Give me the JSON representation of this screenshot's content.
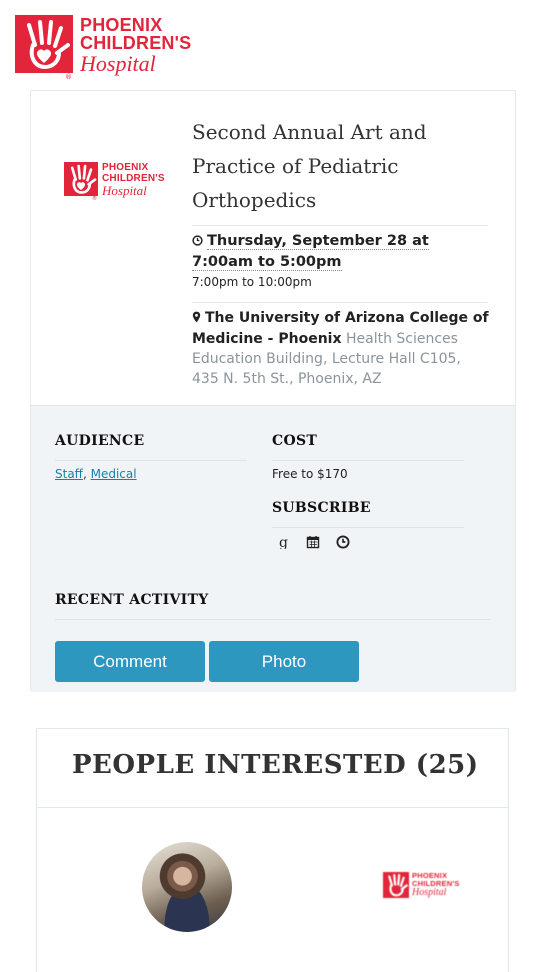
{
  "brand": {
    "line1": "PHOENIX",
    "line2": "CHILDREN'S",
    "line3": "Hospital",
    "registered": "®",
    "color": "#e2253a"
  },
  "event": {
    "title": "Second Annual Art and Practice of Pediatric Orthopedics",
    "when_main": "Thursday, September 28 at",
    "when_range": "7:00am to 5:00pm",
    "when_sub": "7:00pm to 10:00pm",
    "venue": "The University of Arizona College of Medicine - Phoenix",
    "address": "Health Sciences Education Building, Lecture Hall C105, 435 N. 5th St., Phoenix, AZ"
  },
  "details": {
    "audience_label": "AUDIENCE",
    "audience_items": [
      "Staff",
      "Medical"
    ],
    "cost_label": "COST",
    "cost_value": "Free to $170",
    "subscribe_label": "SUBSCRIBE",
    "subscribe_icons": [
      "google-icon",
      "calendar-icon",
      "clock-icon"
    ]
  },
  "activity": {
    "label": "RECENT ACTIVITY",
    "comment_button": "Comment",
    "photo_button": "Photo",
    "button_color": "#2d97bf"
  },
  "people": {
    "title": "PEOPLE INTERESTED (25)"
  }
}
